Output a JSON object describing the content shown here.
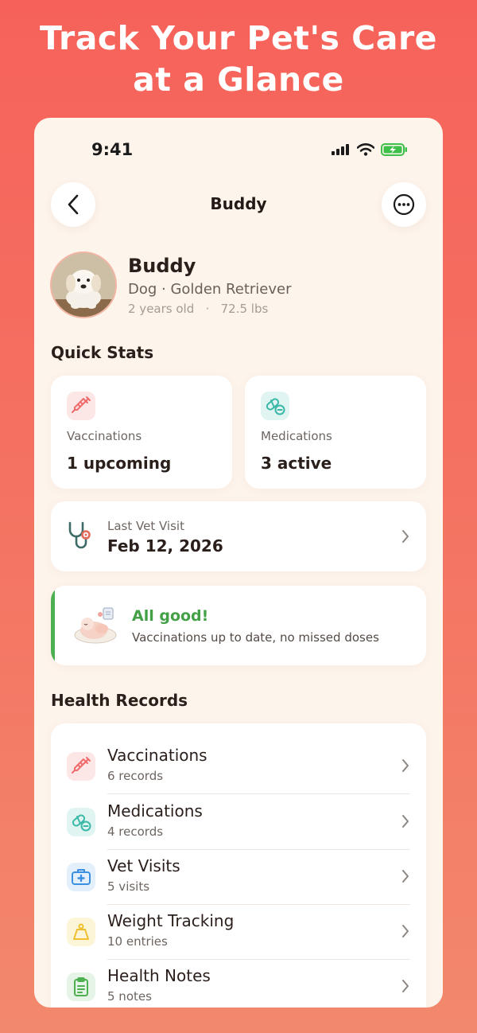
{
  "headline": {
    "line1": "Track Your Pet's Care",
    "line2": "at a Glance"
  },
  "status_bar": {
    "time": "9:41"
  },
  "nav": {
    "title": "Buddy",
    "back_icon": "chevron-left-icon",
    "more_icon": "ellipsis-circle-icon"
  },
  "pet": {
    "name": "Buddy",
    "breed": "Dog · Golden Retriever",
    "age": "2 years old",
    "separator": "·",
    "weight": "72.5 lbs"
  },
  "quick_stats": {
    "title": "Quick Stats",
    "vaccinations": {
      "label": "Vaccinations",
      "value": "1 upcoming",
      "icon": "syringe-icon",
      "color": "#f06b6b"
    },
    "medications": {
      "label": "Medications",
      "value": "3 active",
      "icon": "pill-icon",
      "color": "#3bb8a8"
    }
  },
  "last_vet_visit": {
    "label": "Last Vet Visit",
    "value": "Feb 12, 2026",
    "icon": "stethoscope-icon"
  },
  "status_card": {
    "title": "All good!",
    "subtitle": "Vaccinations up to date, no missed doses",
    "accent": "#4caf50"
  },
  "health_records": {
    "title": "Health Records",
    "items": [
      {
        "title": "Vaccinations",
        "sub": "6 records",
        "icon": "syringe-icon",
        "color": "#f06b6b"
      },
      {
        "title": "Medications",
        "sub": "4 records",
        "icon": "pill-icon",
        "color": "#3bb8a8"
      },
      {
        "title": "Vet Visits",
        "sub": "5 visits",
        "icon": "medical-kit-icon",
        "color": "#3b8fe0"
      },
      {
        "title": "Weight Tracking",
        "sub": "10 entries",
        "icon": "weight-icon",
        "color": "#f0c030"
      },
      {
        "title": "Health Notes",
        "sub": "5 notes",
        "icon": "clipboard-icon",
        "color": "#4caf50"
      }
    ]
  }
}
